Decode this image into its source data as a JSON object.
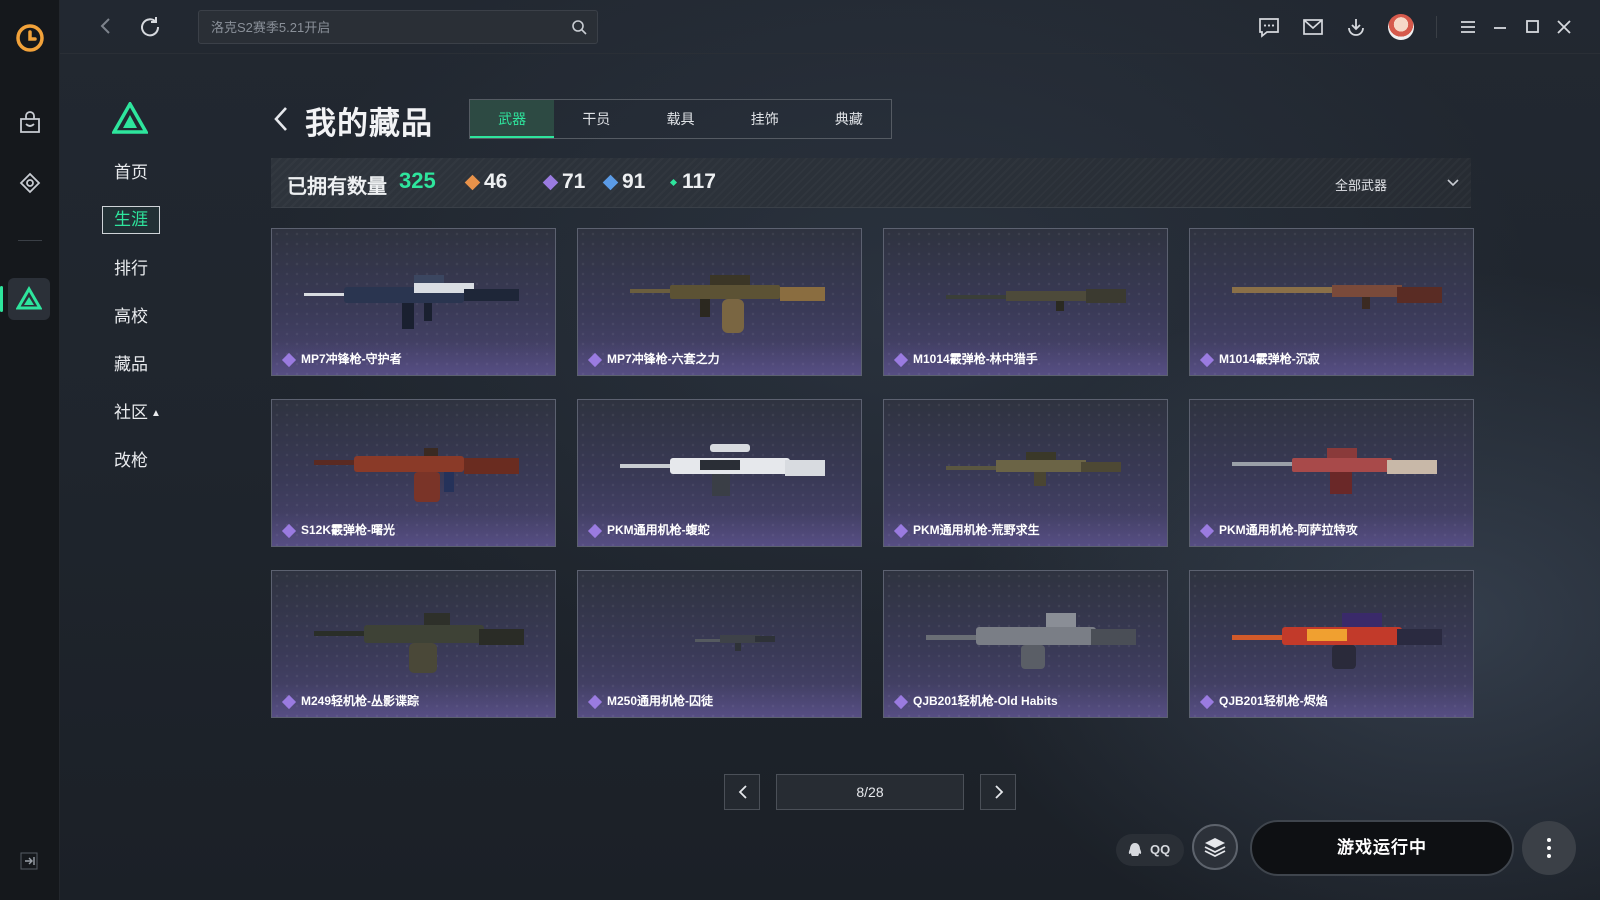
{
  "app": {
    "search_placeholder": "洛克S2赛季5.21开启"
  },
  "sidenav": {
    "items": [
      {
        "label": "首页"
      },
      {
        "label": "生涯"
      },
      {
        "label": "排行"
      },
      {
        "label": "高校"
      },
      {
        "label": "藏品"
      },
      {
        "label": "社区"
      },
      {
        "label": "改枪"
      }
    ],
    "active_index": 1
  },
  "header": {
    "title": "我的藏品",
    "tabs": [
      {
        "label": "武器"
      },
      {
        "label": "干员"
      },
      {
        "label": "载具"
      },
      {
        "label": "挂饰"
      },
      {
        "label": "典藏"
      }
    ],
    "active_tab": 0
  },
  "stats": {
    "owned_label": "已拥有数量",
    "owned_value": "325",
    "counts": [
      {
        "value": "46",
        "color": "#e8924a"
      },
      {
        "value": "71",
        "color": "#9a7be0"
      },
      {
        "value": "91",
        "color": "#5b9be6"
      },
      {
        "value": "117",
        "color": "#2ee59d"
      }
    ],
    "filter_label": "全部武器"
  },
  "items": [
    {
      "name": "MP7冲锋枪-守护者"
    },
    {
      "name": "MP7冲锋枪-六套之力"
    },
    {
      "name": "M1014霰弹枪-林中猎手"
    },
    {
      "name": "M1014霰弹枪-沉寂"
    },
    {
      "name": "S12K霰弹枪-曙光"
    },
    {
      "name": "PKM通用机枪-蝮蛇"
    },
    {
      "name": "PKM通用机枪-荒野求生"
    },
    {
      "name": "PKM通用机枪-阿萨拉特攻"
    },
    {
      "name": "M249轻机枪-丛影谍踪"
    },
    {
      "name": "M250通用机枪-囚徒"
    },
    {
      "name": "QJB201轻机枪-Old Habits"
    },
    {
      "name": "QJB201轻机枪-烬焰"
    }
  ],
  "pagination": {
    "label": "8/28"
  },
  "footer": {
    "qq_label": "QQ",
    "launch_label": "游戏运行中"
  },
  "colors": {
    "accent": "#2ee59d",
    "rarity_purple": "#9a7be0"
  }
}
